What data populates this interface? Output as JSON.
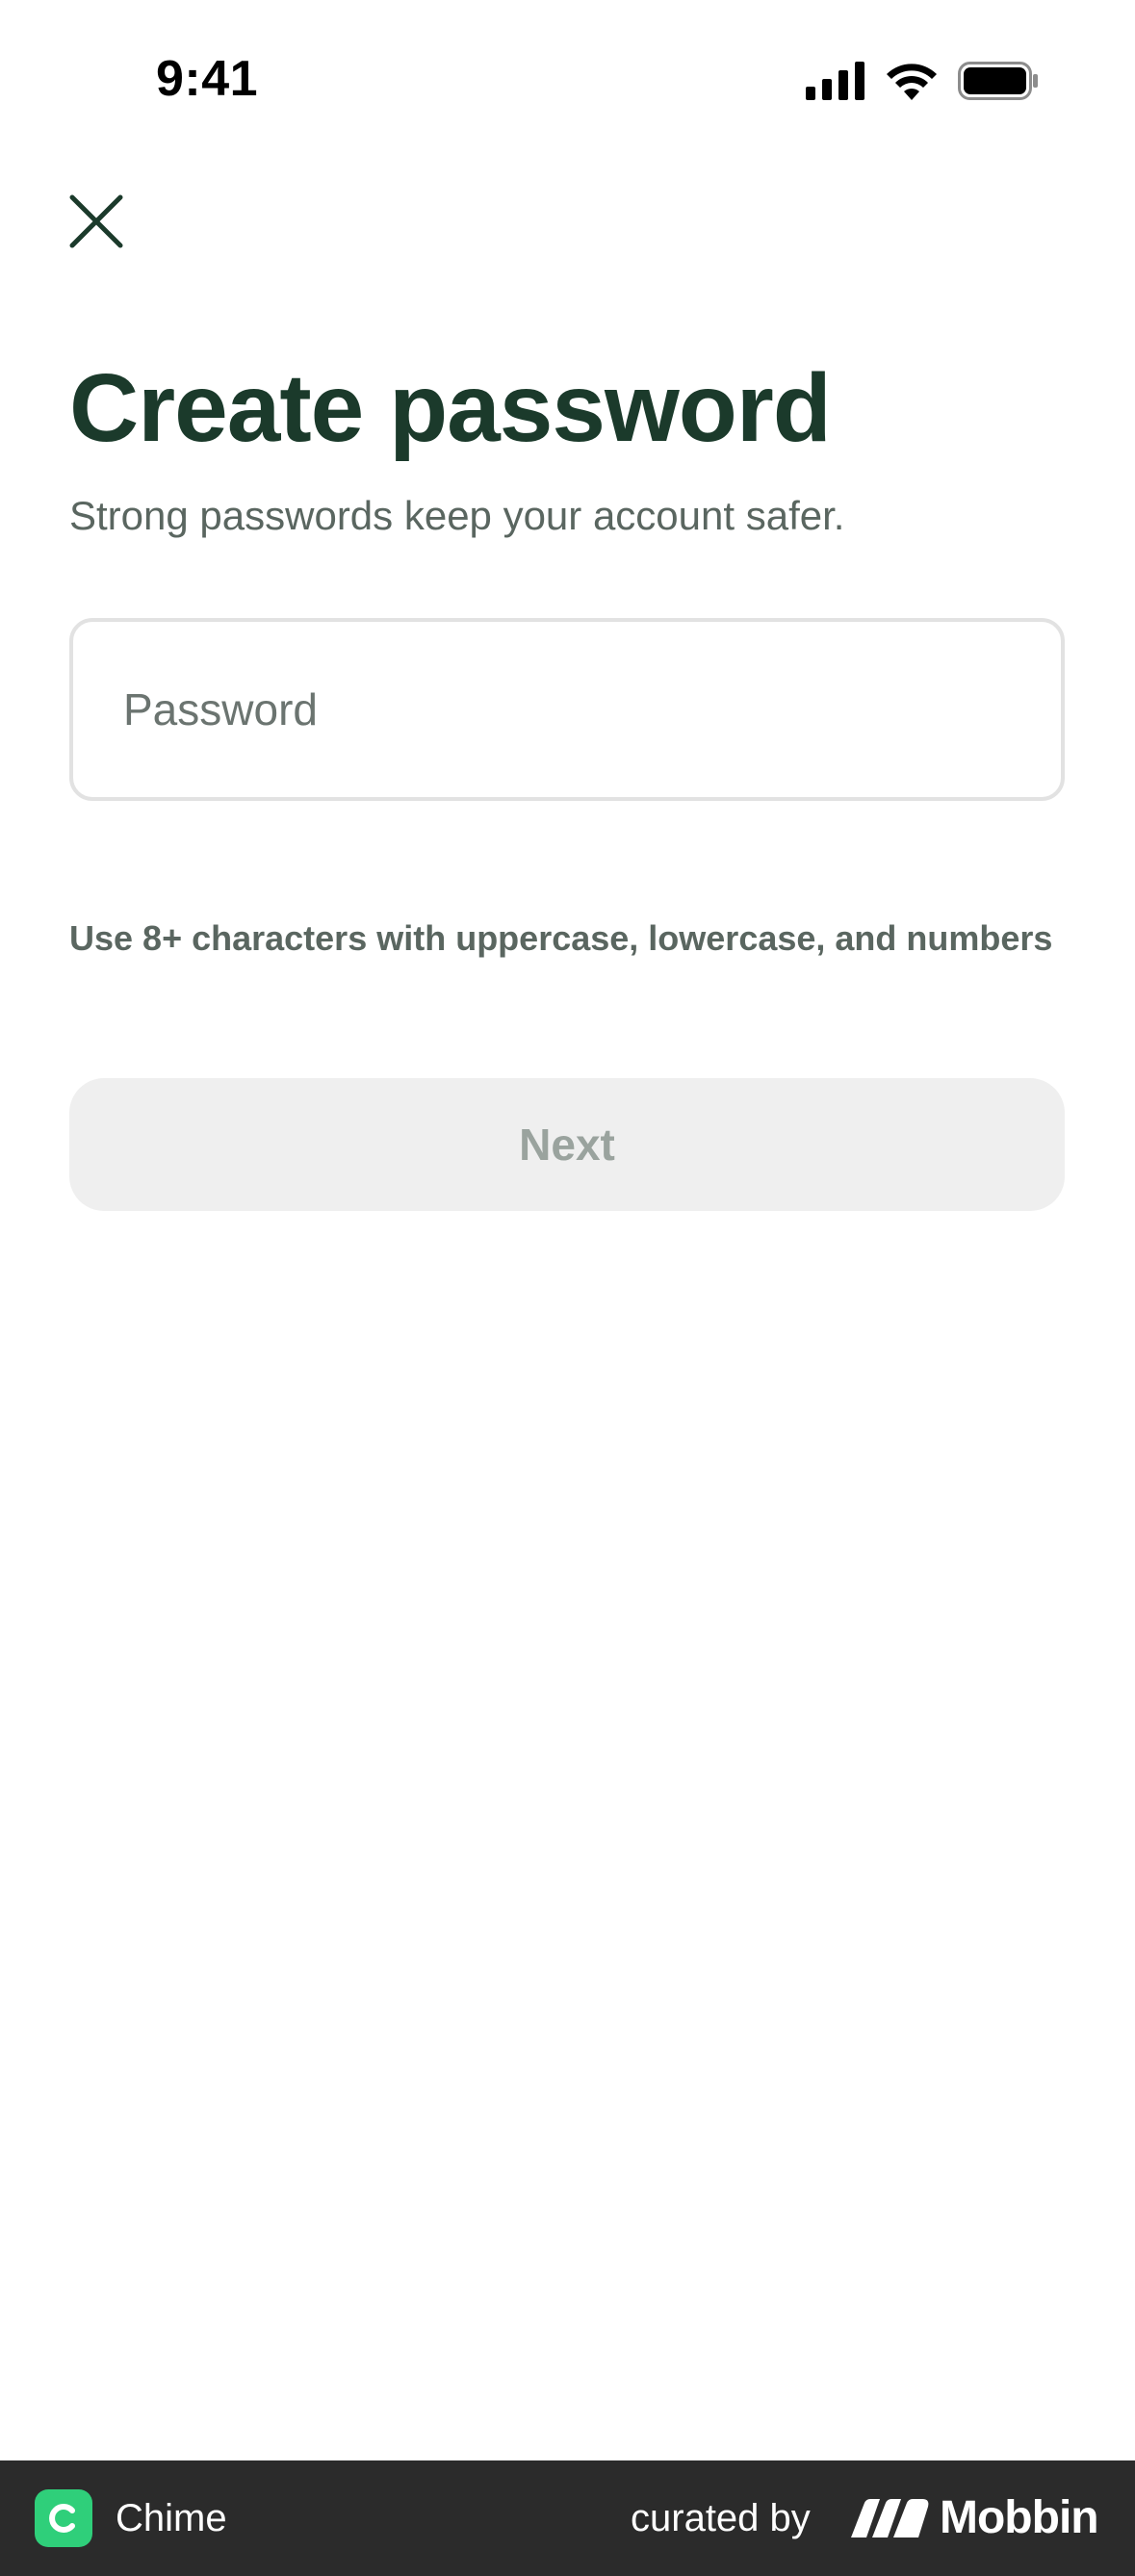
{
  "status_bar": {
    "time": "9:41",
    "icons": [
      "signal-icon",
      "wifi-icon",
      "battery-icon"
    ]
  },
  "header": {
    "close_icon": "close-icon"
  },
  "main": {
    "title": "Create password",
    "subtitle": "Strong passwords keep your account safer.",
    "password_field": {
      "placeholder": "Password",
      "value": ""
    },
    "hint": "Use 8+ characters with uppercase, lowercase, and numbers",
    "next_label": "Next"
  },
  "footer": {
    "app_name": "Chime",
    "app_icon_letter": "C",
    "curated_by": "curated by",
    "mobbin_label": "Mobbin"
  },
  "colors": {
    "title": "#1b3a2b",
    "secondary_text": "#5a6660",
    "button_disabled_bg": "#efefef",
    "button_disabled_text": "#9aa39e",
    "field_border": "#e2e2e2",
    "footer_bg": "#2b2b2b",
    "brand_green": "#2fcf7a"
  }
}
